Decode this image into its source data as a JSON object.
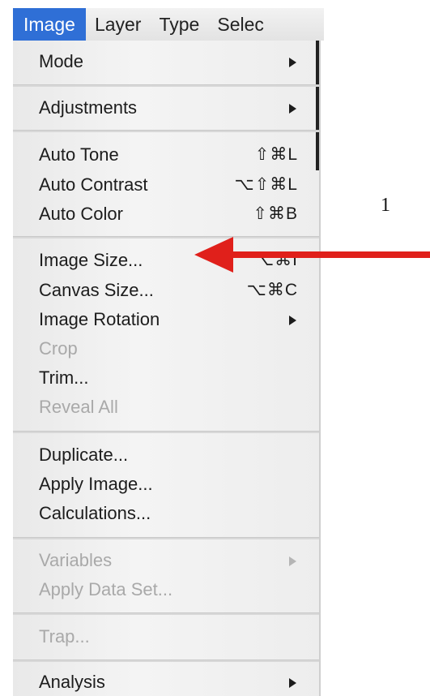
{
  "menubar": {
    "items": [
      {
        "label": "Image",
        "active": true
      },
      {
        "label": "Layer"
      },
      {
        "label": "Type"
      },
      {
        "label": "Selec"
      }
    ]
  },
  "menu": {
    "items": [
      {
        "label": "Mode",
        "submenu": true
      },
      {
        "label": "Adjustments",
        "submenu": true
      },
      {
        "label": "Auto Tone",
        "shortcut": "⇧⌘L"
      },
      {
        "label": "Auto Contrast",
        "shortcut": "⌥⇧⌘L"
      },
      {
        "label": "Auto Color",
        "shortcut": "⇧⌘B"
      },
      {
        "label": "Image Size...",
        "shortcut": "⌥⌘I"
      },
      {
        "label": "Canvas Size...",
        "shortcut": "⌥⌘C"
      },
      {
        "label": "Image Rotation",
        "submenu": true
      },
      {
        "label": "Crop",
        "disabled": true
      },
      {
        "label": "Trim..."
      },
      {
        "label": "Reveal All",
        "disabled": true
      },
      {
        "label": "Duplicate..."
      },
      {
        "label": "Apply Image..."
      },
      {
        "label": "Calculations..."
      },
      {
        "label": "Variables",
        "submenu": true,
        "disabled": true
      },
      {
        "label": "Apply Data Set...",
        "disabled": true
      },
      {
        "label": "Trap...",
        "disabled": true
      },
      {
        "label": "Analysis",
        "submenu": true
      }
    ]
  },
  "annotation": {
    "number": "1",
    "arrow_color": "#e0201b"
  },
  "colors": {
    "menubar_active": "#2f6fd6",
    "disabled_text": "#a9a9a9"
  }
}
